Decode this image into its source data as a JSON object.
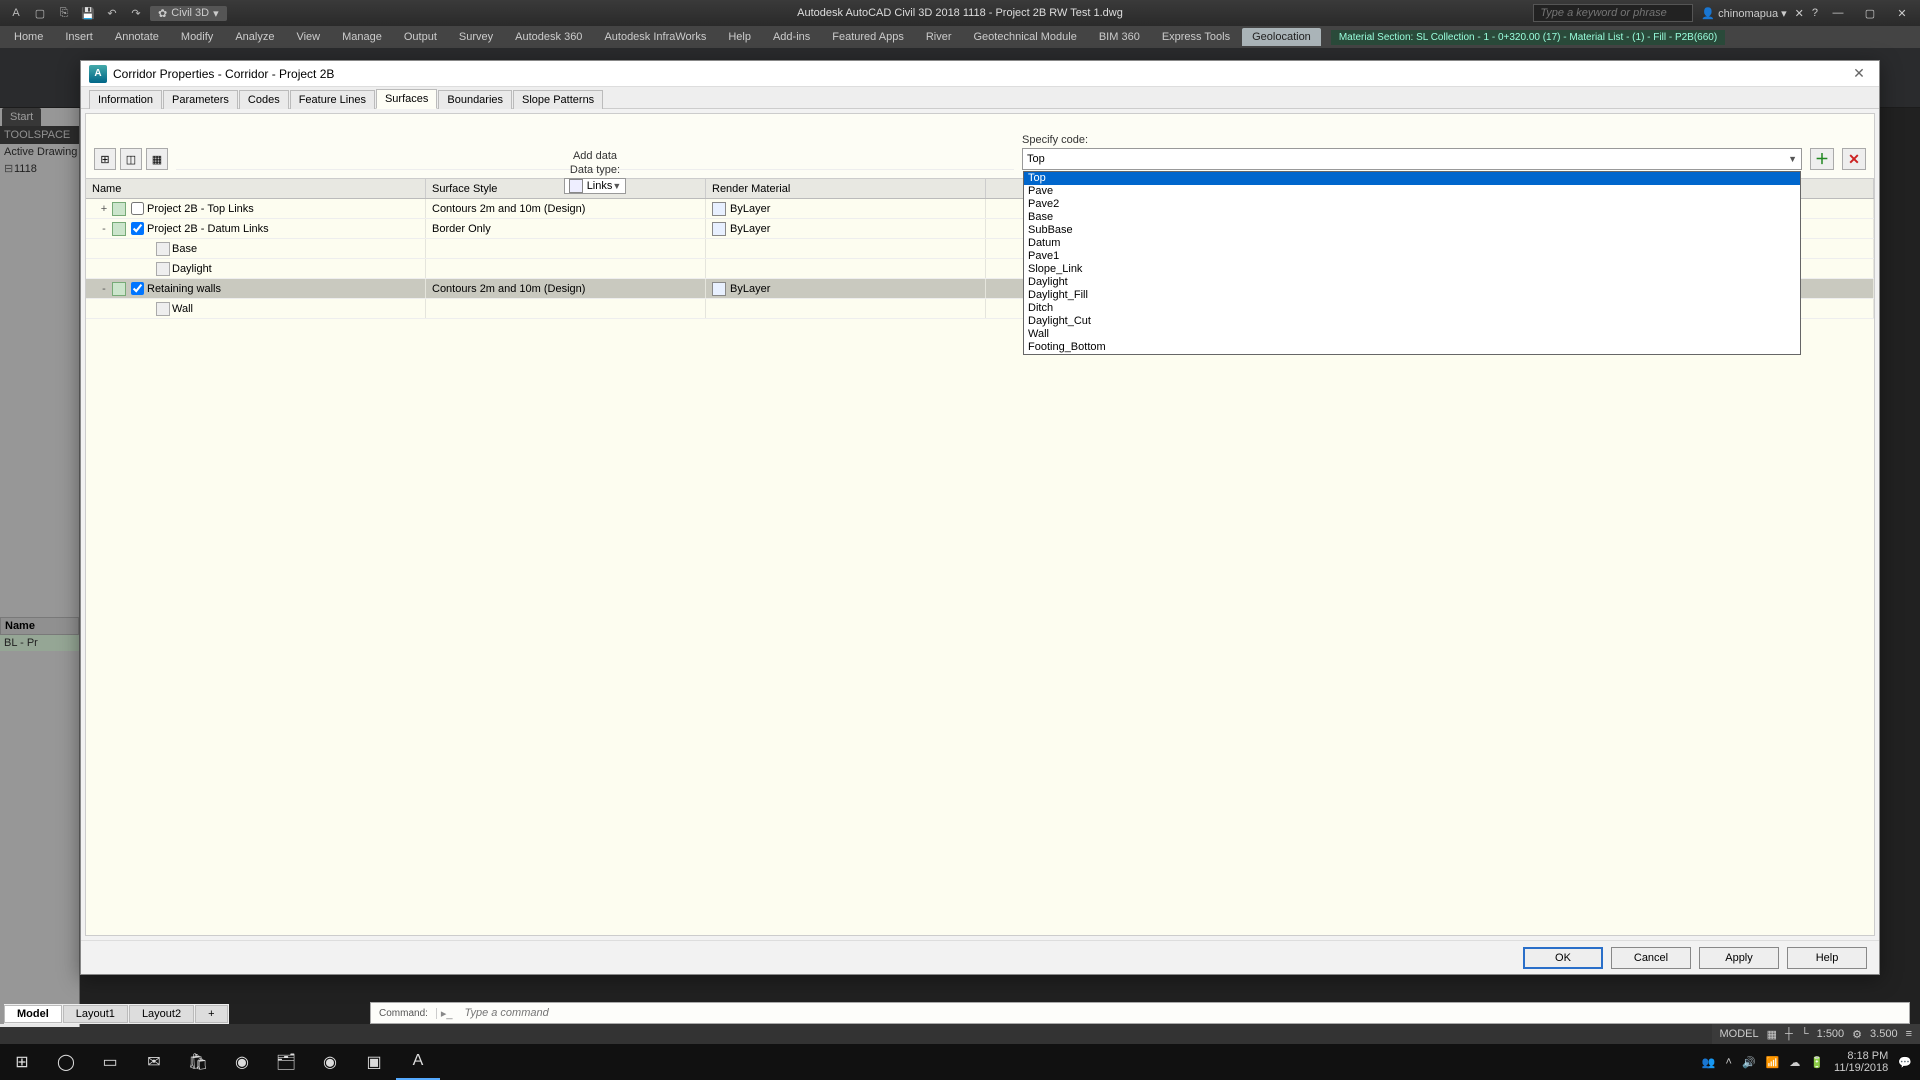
{
  "app": {
    "brand": "Civil 3D",
    "title": "Autodesk AutoCAD Civil 3D 2018    1118 - Project 2B RW Test 1.dwg",
    "search_placeholder": "Type a keyword or phrase",
    "user": "chinomapua",
    "context_panel": "Material Section: SL Collection - 1 - 0+320.00 (17) - Material List - (1) - Fill - P2B(660)"
  },
  "ribbon": {
    "tabs": [
      "Home",
      "Insert",
      "Annotate",
      "Modify",
      "Analyze",
      "View",
      "Manage",
      "Output",
      "Survey",
      "Autodesk 360",
      "Autodesk InfraWorks",
      "Help",
      "Add-ins",
      "Featured Apps",
      "River",
      "Geotechnical Module",
      "BIM 360",
      "Express Tools",
      "Geolocation"
    ],
    "active": "Geolocation"
  },
  "left": {
    "start": "Start",
    "toolspace": "TOOLSPACE",
    "active_drawing": "Active Drawing",
    "root": "1118",
    "name_header": "Name",
    "bl": "BL - Pr"
  },
  "modeltabs": {
    "tabs": [
      "Model",
      "Layout1",
      "Layout2"
    ],
    "active": "Model",
    "add": "+"
  },
  "status": {
    "model": "MODEL",
    "scale": "1:500",
    "num": "3.500"
  },
  "cmd": {
    "hist": "Command:",
    "placeholder": "Type a command"
  },
  "taskbar": {
    "time": "8:18 PM",
    "date": "11/19/2018"
  },
  "dialog": {
    "title": "Corridor Properties - Corridor - Project 2B",
    "tabs": [
      "Information",
      "Parameters",
      "Codes",
      "Feature Lines",
      "Surfaces",
      "Boundaries",
      "Slope Patterns"
    ],
    "active_tab": "Surfaces",
    "add_data": "Add data",
    "datatype_label": "Data type:",
    "datatype_value": "Links",
    "specify_label": "Specify code:",
    "specify_value": "Top",
    "spec_options": [
      "Top",
      "Pave",
      "Pave2",
      "Base",
      "SubBase",
      "Datum",
      "Pave1",
      "Slope_Link",
      "Daylight",
      "Daylight_Fill",
      "Ditch",
      "Daylight_Cut",
      "Wall",
      "Footing_Bottom"
    ],
    "spec_selected": "Top",
    "headers": {
      "name": "Name",
      "style": "Surface Style",
      "mat": "Render Material",
      "oh": ""
    },
    "rows": [
      {
        "type": "surf",
        "level": 1,
        "checked": false,
        "name": "Project 2B - Top Links",
        "style": "Contours 2m and 10m (Design)",
        "mat": "ByLayer",
        "exp": "+"
      },
      {
        "type": "surf",
        "level": 1,
        "checked": true,
        "name": "Project 2B - Datum Links",
        "style": "Border Only",
        "mat": "ByLayer",
        "exp": "-"
      },
      {
        "type": "link",
        "level": 2,
        "name": "Base"
      },
      {
        "type": "link",
        "level": 2,
        "name": "Daylight"
      },
      {
        "type": "surf",
        "level": 1,
        "checked": true,
        "name": "Retaining walls",
        "style": "Contours 2m and 10m (Design)",
        "mat": "ByLayer",
        "exp": "-",
        "selected": true
      },
      {
        "type": "link",
        "level": 2,
        "name": "Wall"
      }
    ],
    "buttons": {
      "ok": "OK",
      "cancel": "Cancel",
      "apply": "Apply",
      "help": "Help"
    }
  }
}
